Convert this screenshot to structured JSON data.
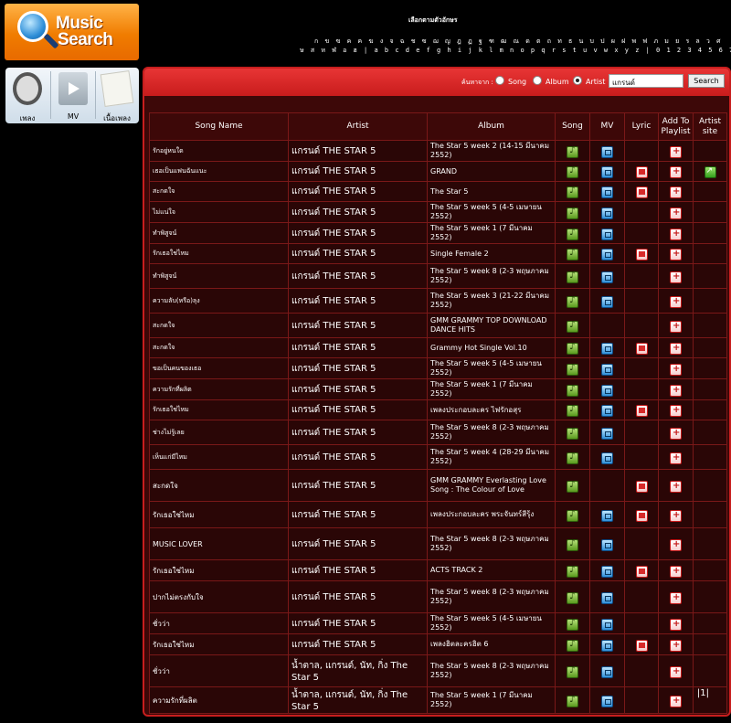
{
  "logo": {
    "line1": "Music",
    "line2": "Search"
  },
  "alphabet": {
    "title": "เลือกตามตัวอักษร",
    "thai_row": "ก ข ฃ ค ฅ ฆ ง จ ฉ ช ซ ฌ ญ ฎ ฏ ฐ ฑ ฒ ณ ด ต ถ ท ธ น บ ป ผ ฝ พ ฟ ภ ม ย ร ล ว ศ",
    "latin_row": "ษ ส ห ฬ อ ฮ | a b c d e f g h i j k l m n o p q r s t u v w x y z | 0 1 2 3 4 5 6 7 8 9"
  },
  "side_menu": [
    {
      "label": "เพลง",
      "icon": "headphones-icon"
    },
    {
      "label": "MV",
      "icon": "film-icon"
    },
    {
      "label": "เนื้อเพลง",
      "icon": "lyrics-note-icon"
    }
  ],
  "search": {
    "label": "ค้นหาจาก :",
    "options": [
      "Song",
      "Album",
      "Artist"
    ],
    "selected": "Artist",
    "query": "แกรนด์",
    "button": "Search"
  },
  "table": {
    "columns": [
      "Song Name",
      "Artist",
      "Album",
      "Song",
      "MV",
      "Lyric",
      "Add To Playlist",
      "Artist site"
    ],
    "rows": [
      {
        "song": "รักอยู่หนใด",
        "artist": "แกรนด์ THE STAR 5",
        "album": "The Star 5 week 2 (14-15 มีนาคม 2552)",
        "s": true,
        "mv": true,
        "ly": false,
        "add": true,
        "site": false
      },
      {
        "song": "เธอเป็นแฟนฉันแนะ",
        "artist": "แกรนด์ THE STAR 5",
        "album": "GRAND",
        "s": true,
        "mv": true,
        "ly": true,
        "add": true,
        "site": true
      },
      {
        "song": "สะกดใจ",
        "artist": "แกรนด์ THE STAR 5",
        "album": "The Star 5",
        "s": true,
        "mv": true,
        "ly": true,
        "add": true,
        "site": false
      },
      {
        "song": "ไม่แน่ใจ",
        "artist": "แกรนด์ THE STAR 5",
        "album": "The Star 5 week 5 (4-5 เมษายน 2552)",
        "s": true,
        "mv": true,
        "ly": false,
        "add": true,
        "site": false
      },
      {
        "song": "ทำพิสูจน์",
        "artist": "แกรนด์ THE STAR 5",
        "album": "The Star 5 week 1 (7 มีนาคม 2552)",
        "s": true,
        "mv": true,
        "ly": false,
        "add": true,
        "site": false
      },
      {
        "song": "รักเธอใช่ไหม",
        "artist": "แกรนด์ THE STAR 5",
        "album": "Single Female 2",
        "s": true,
        "mv": true,
        "ly": true,
        "add": true,
        "site": false
      },
      {
        "song": "ทำพิสูจน์",
        "artist": "แกรนด์ THE STAR 5",
        "album": "The Star 5 week 8 (2-3 พฤษภาคม 2552)",
        "s": true,
        "mv": true,
        "ly": false,
        "add": true,
        "site": false
      },
      {
        "song": "ความลับ(หรือ)ลุง",
        "artist": "แกรนด์ THE STAR 5",
        "album": "The Star 5 week 3 (21-22 มีนาคม 2552)",
        "s": true,
        "mv": true,
        "ly": false,
        "add": true,
        "site": false
      },
      {
        "song": "สะกดใจ",
        "artist": "แกรนด์ THE STAR 5",
        "album": "GMM GRAMMY TOP DOWNLOAD DANCE HITS",
        "s": true,
        "mv": false,
        "ly": false,
        "add": true,
        "site": false
      },
      {
        "song": "สะกดใจ",
        "artist": "แกรนด์ THE STAR 5",
        "album": "Grammy Hot Single Vol.10",
        "s": true,
        "mv": true,
        "ly": true,
        "add": true,
        "site": false
      },
      {
        "song": "ขอเป็นคนของเธอ",
        "artist": "แกรนด์ THE STAR 5",
        "album": "The Star 5 week 5 (4-5 เมษายน 2552)",
        "s": true,
        "mv": true,
        "ly": false,
        "add": true,
        "site": false
      },
      {
        "song": "ความรักที่ผลิต",
        "artist": "แกรนด์ THE STAR 5",
        "album": "The Star 5 week 1 (7 มีนาคม 2552)",
        "s": true,
        "mv": true,
        "ly": false,
        "add": true,
        "site": false
      },
      {
        "song": "รักเธอใช่ไหม",
        "artist": "แกรนด์ THE STAR 5",
        "album": "เพลงประกอบละคร ไฟรักอสุร",
        "s": true,
        "mv": true,
        "ly": true,
        "add": true,
        "site": false
      },
      {
        "song": "ช่างไม่รู้เลย",
        "artist": "แกรนด์ THE STAR 5",
        "album": "The Star 5 week 8 (2-3 พฤษภาคม 2552)",
        "s": true,
        "mv": true,
        "ly": false,
        "add": true,
        "site": false
      },
      {
        "song": "เห็นแก่มีไหม",
        "artist": "แกรนด์ THE STAR 5",
        "album": "The Star 5 week 4 (28-29 มีนาคม 2552)",
        "s": true,
        "mv": true,
        "ly": false,
        "add": true,
        "site": false
      },
      {
        "song": "สะกดใจ",
        "artist": "แกรนด์ THE STAR 5",
        "album": "GMM GRAMMY Everlasting Love Song : The Colour of Love",
        "s": true,
        "mv": false,
        "ly": true,
        "add": true,
        "site": false
      },
      {
        "song": "รักเธอใช่ไหม",
        "artist": "แกรนด์ THE STAR 5",
        "album": "เพลงประกอบละคร พระจันทร์สีรุ้ง",
        "s": true,
        "mv": true,
        "ly": true,
        "add": true,
        "site": false
      },
      {
        "song": "MUSIC LOVER",
        "artist": "แกรนด์ THE STAR 5",
        "album": "The Star 5 week 8 (2-3 พฤษภาคม 2552)",
        "s": true,
        "mv": true,
        "ly": false,
        "add": true,
        "site": false
      },
      {
        "song": "รักเธอใช่ไหม",
        "artist": "แกรนด์ THE STAR 5",
        "album": "ACTS TRACK 2",
        "s": true,
        "mv": true,
        "ly": true,
        "add": true,
        "site": false
      },
      {
        "song": "ปากไม่ตรงกับใจ",
        "artist": "แกรนด์ THE STAR 5",
        "album": "The Star 5 week 8 (2-3 พฤษภาคม 2552)",
        "s": true,
        "mv": true,
        "ly": false,
        "add": true,
        "site": false
      },
      {
        "song": "ชั่วว่า",
        "artist": "แกรนด์ THE STAR 5",
        "album": "The Star 5 week 5 (4-5 เมษายน 2552)",
        "s": true,
        "mv": true,
        "ly": false,
        "add": true,
        "site": false
      },
      {
        "song": "รักเธอใช่ไหม",
        "artist": "แกรนด์ THE STAR 5",
        "album": "เพลงฮิตละครฮิต 6",
        "s": true,
        "mv": true,
        "ly": true,
        "add": true,
        "site": false
      },
      {
        "song": "ชั่วว่า",
        "artist": "น้ำตาล, แกรนด์, นัท, กิ่ง The Star 5",
        "album": "The Star 5 week 8 (2-3 พฤษภาคม 2552)",
        "s": true,
        "mv": true,
        "ly": false,
        "add": true,
        "site": false
      },
      {
        "song": "ความรักที่ผลิต",
        "artist": "น้ำตาล, แกรนด์, นัท, กิ่ง The Star 5",
        "album": "The Star 5 week 1 (7 มีนาคม 2552)",
        "s": true,
        "mv": true,
        "ly": false,
        "add": true,
        "site": false
      }
    ]
  },
  "pager": "|1|"
}
